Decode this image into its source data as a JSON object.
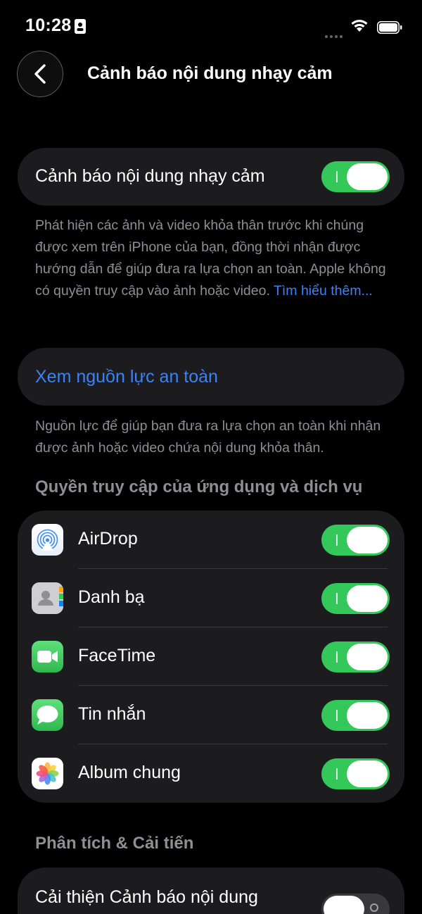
{
  "status_bar": {
    "time": "10:28"
  },
  "nav": {
    "title": "Cảnh báo nội dung nhạy cảm"
  },
  "main_toggle": {
    "label": "Cảnh báo nội dung nhạy cảm",
    "on": true
  },
  "main_footer": {
    "text": "Phát hiện các ảnh và video khỏa thân trước khi chúng được xem trên iPhone của bạn, đồng thời nhận được hướng dẫn để giúp đưa ra lựa chọn an toàn. Apple không có quyền truy cập vào ảnh hoặc video. ",
    "link": "Tìm hiểu thêm..."
  },
  "resources": {
    "label": "Xem nguồn lực an toàn",
    "footer": "Nguồn lực để giúp bạn đưa ra lựa chọn an toàn khi nhận được ảnh hoặc video chứa nội dung khỏa thân."
  },
  "app_access": {
    "header": "Quyền truy cập của ứng dụng và dịch vụ",
    "items": [
      {
        "label": "AirDrop",
        "icon": "airdrop-icon",
        "on": true
      },
      {
        "label": "Danh bạ",
        "icon": "contacts-icon",
        "on": true
      },
      {
        "label": "FaceTime",
        "icon": "facetime-icon",
        "on": true
      },
      {
        "label": "Tin nhắn",
        "icon": "messages-icon",
        "on": true
      },
      {
        "label": "Album chung",
        "icon": "photos-icon",
        "on": true
      }
    ]
  },
  "analytics": {
    "header": "Phân tích & Cải tiến",
    "item_label": "Cải thiện Cảnh báo nội dung",
    "on": false
  },
  "colors": {
    "background": "#000000",
    "card": "#1c1c1e",
    "toggle_on": "#34c759",
    "link": "#3b82f6",
    "secondary_text": "#8e8e93"
  }
}
